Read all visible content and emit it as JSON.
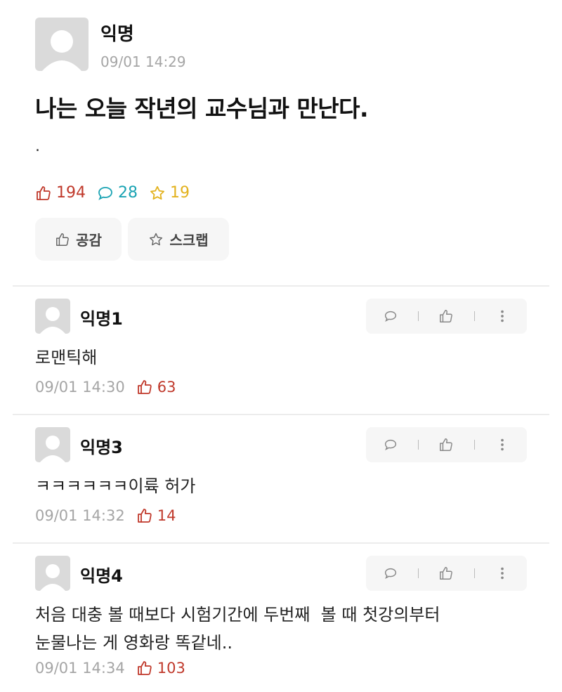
{
  "post": {
    "author": "익명",
    "time": "09/01 14:29",
    "title": "나는 오늘 작년의 교수님과 만난다.",
    "body": ".",
    "stats": {
      "likes": "194",
      "comments": "28",
      "scraps": "19"
    },
    "buttons": {
      "like_label": "공감",
      "scrap_label": "스크랩"
    }
  },
  "comments": [
    {
      "author": "익명1",
      "text": "로맨틱해",
      "time": "09/01 14:30",
      "likes": "63"
    },
    {
      "author": "익명3",
      "text": "ㅋㅋㅋㅋㅋㅋ이륙 허가",
      "time": "09/01 14:32",
      "likes": "14"
    },
    {
      "author": "익명4",
      "text_line1": "처음 대충 볼 때보다 시험기간에 두번째  볼 때 첫강의부터",
      "text_line2": "눈물나는 게 영화랑 똑같네..",
      "time": "09/01 14:34",
      "likes": "103"
    }
  ],
  "colors": {
    "like": "#c0392b",
    "comment": "#1aa3b3",
    "scrap": "#e3b21e",
    "meta": "#a5a5a5"
  }
}
